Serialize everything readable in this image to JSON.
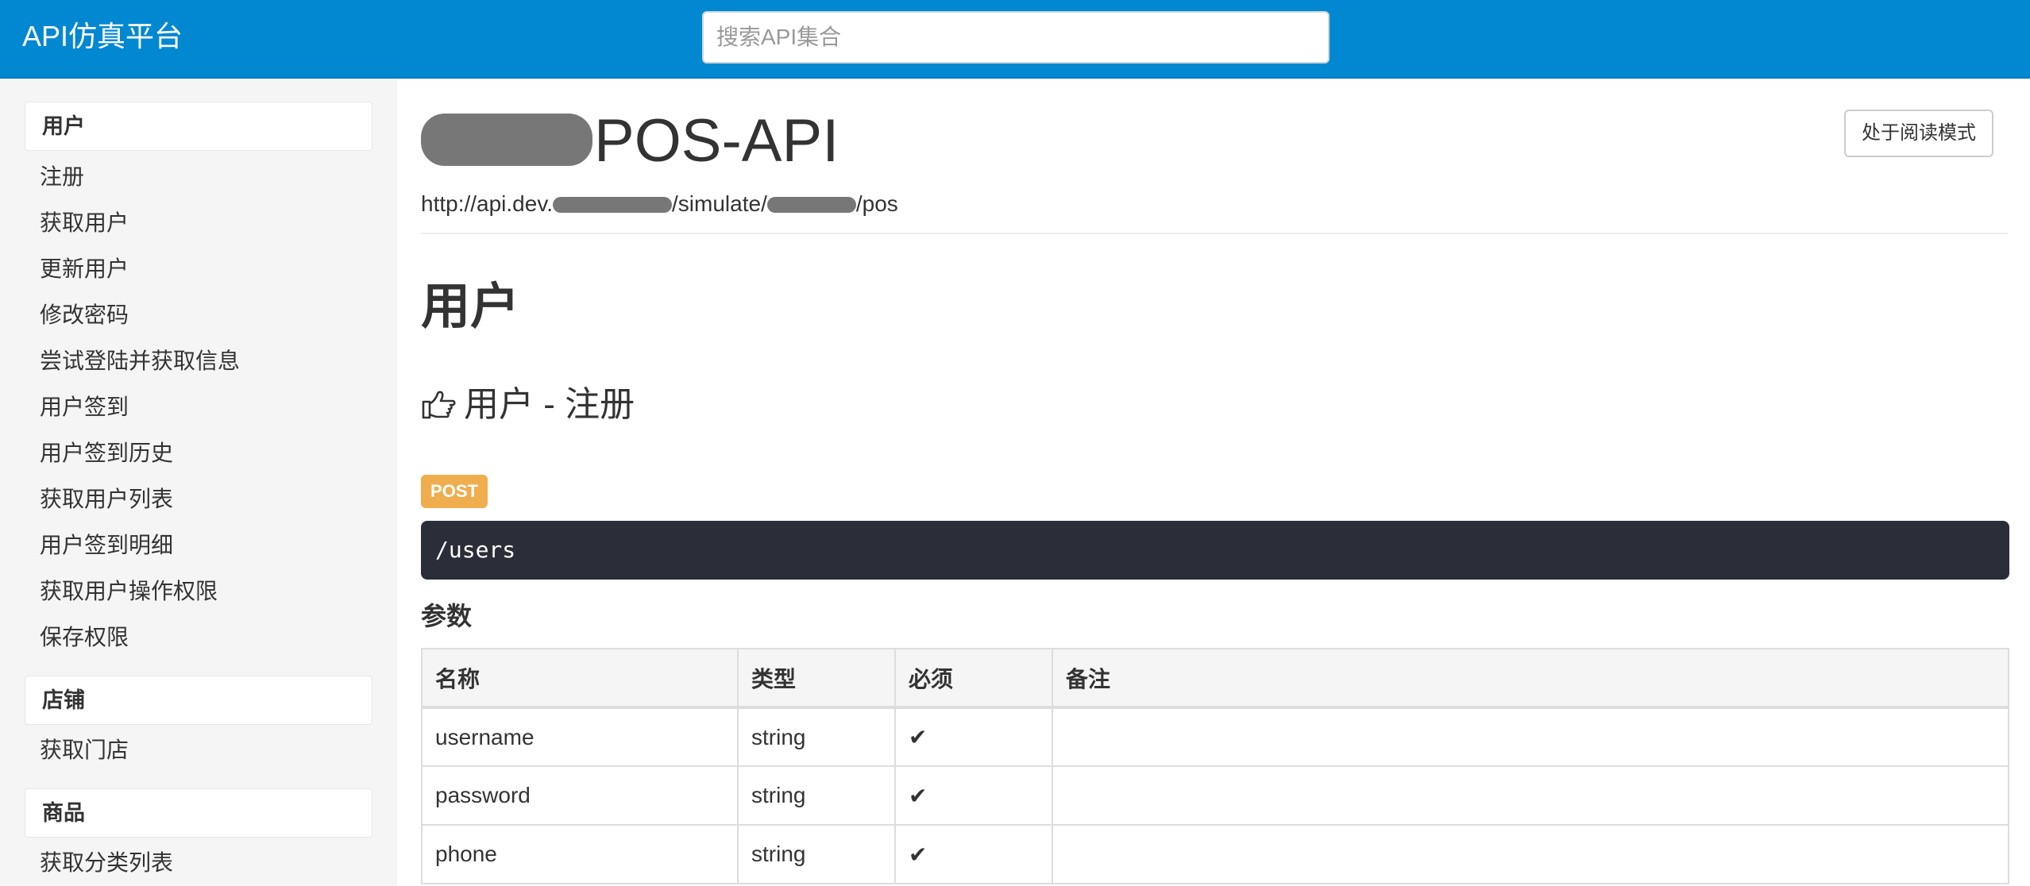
{
  "app": {
    "title": "API仿真平台"
  },
  "search": {
    "placeholder": "搜索API集合"
  },
  "sidebar": {
    "groups": [
      {
        "label": "用户",
        "items": [
          "注册",
          "获取用户",
          "更新用户",
          "修改密码",
          "尝试登陆并获取信息",
          "用户签到",
          "用户签到历史",
          "获取用户列表",
          "用户签到明细",
          "获取用户操作权限",
          "保存权限"
        ]
      },
      {
        "label": "店铺",
        "items": [
          "获取门店"
        ]
      },
      {
        "label": "商品",
        "items": [
          "获取分类列表"
        ]
      }
    ]
  },
  "header": {
    "title": "POS-API",
    "url_parts": [
      "http://api.dev.",
      "/simulate/",
      "/pos"
    ],
    "read_mode_button": "处于阅读模式"
  },
  "section": {
    "title": "用户"
  },
  "api": {
    "title": "用户 - 注册",
    "method": "POST",
    "path": "/users",
    "params_title": "参数",
    "columns": [
      "名称",
      "类型",
      "必须",
      "备注"
    ],
    "rows": [
      {
        "name": "username",
        "type": "string",
        "required": "✔",
        "note": ""
      },
      {
        "name": "password",
        "type": "string",
        "required": "✔",
        "note": ""
      },
      {
        "name": "phone",
        "type": "string",
        "required": "✔",
        "note": ""
      }
    ]
  },
  "colors": {
    "navbar": "#0288d1",
    "badge_post": "#f0ad4e",
    "code_bg": "#2b2d38",
    "sidebar_bg": "#f5f5f5"
  },
  "icons": {
    "api_heading": "hand-point-right-icon",
    "required": "check-icon"
  }
}
